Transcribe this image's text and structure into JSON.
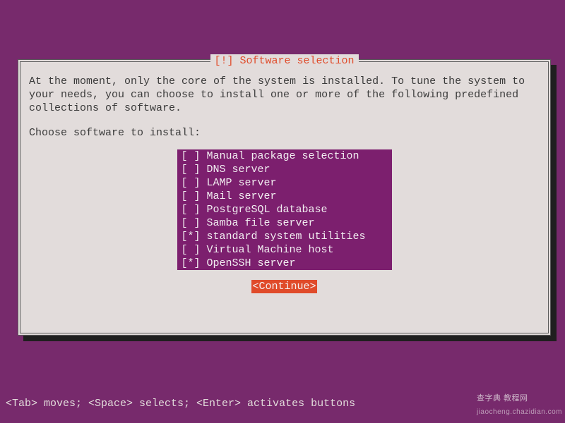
{
  "colors": {
    "background": "#772a6c",
    "dialog_bg": "#e2dcdb",
    "accent": "#e04b2a",
    "selection_bg": "#7c1f6e",
    "selection_fg": "#f2eef1"
  },
  "dialog": {
    "title": "[!] Software selection",
    "description": "At the moment, only the core of the system is installed. To tune the system to your needs, you can choose to install one or more of the following predefined collections of software.",
    "prompt": "Choose software to install:",
    "options": [
      {
        "label": "Manual package selection",
        "checked": false
      },
      {
        "label": "DNS server",
        "checked": false
      },
      {
        "label": "LAMP server",
        "checked": false
      },
      {
        "label": "Mail server",
        "checked": false
      },
      {
        "label": "PostgreSQL database",
        "checked": false
      },
      {
        "label": "Samba file server",
        "checked": false
      },
      {
        "label": "standard system utilities",
        "checked": true
      },
      {
        "label": "Virtual Machine host",
        "checked": false
      },
      {
        "label": "OpenSSH server",
        "checked": true
      }
    ],
    "continue_label": "<Continue>"
  },
  "help_line": "<Tab> moves; <Space> selects; <Enter> activates buttons",
  "watermark": {
    "primary": "查字典  教程网",
    "secondary": "jiaocheng.chazidian.com"
  }
}
